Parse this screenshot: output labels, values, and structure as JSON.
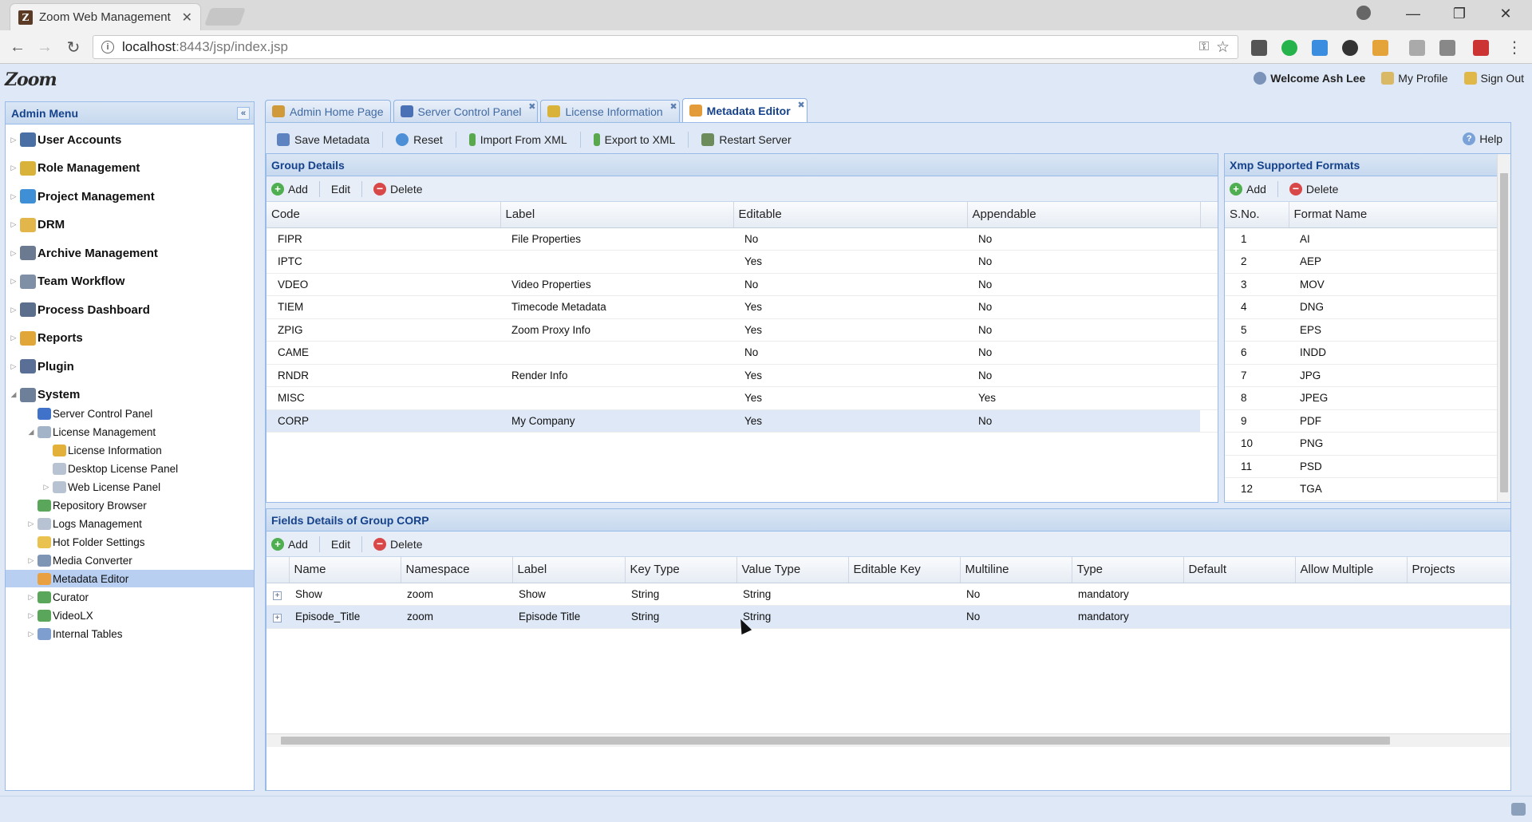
{
  "browser": {
    "tab_title": "Zoom Web Management",
    "tab_favicon": "Z",
    "url_host": "localhost",
    "url_rest": ":8443/jsp/index.jsp"
  },
  "app": {
    "logo": "Zoom",
    "welcome": "Welcome Ash Lee",
    "my_profile": "My Profile",
    "sign_out": "Sign Out"
  },
  "sidebar": {
    "title": "Admin Menu",
    "items": [
      {
        "label": "User Accounts",
        "icon": "users-icon"
      },
      {
        "label": "Role Management",
        "icon": "shield-icon"
      },
      {
        "label": "Project Management",
        "icon": "globe-icon"
      },
      {
        "label": "DRM",
        "icon": "folder-icon"
      },
      {
        "label": "Archive Management",
        "icon": "archive-icon"
      },
      {
        "label": "Team Workflow",
        "icon": "workflow-icon"
      },
      {
        "label": "Process Dashboard",
        "icon": "dashboard-icon"
      },
      {
        "label": "Reports",
        "icon": "reports-icon"
      },
      {
        "label": "Plugin",
        "icon": "plugin-icon"
      },
      {
        "label": "System",
        "icon": "system-icon"
      }
    ],
    "system_children": [
      {
        "label": "Server Control Panel",
        "level": 1
      },
      {
        "label": "License Management",
        "level": 1
      },
      {
        "label": "License Information",
        "level": 2
      },
      {
        "label": "Desktop License Panel",
        "level": 2
      },
      {
        "label": "Web License Panel",
        "level": 2
      },
      {
        "label": "Repository Browser",
        "level": 1
      },
      {
        "label": "Logs Management",
        "level": 1
      },
      {
        "label": "Hot Folder Settings",
        "level": 1
      },
      {
        "label": "Media Converter",
        "level": 1
      },
      {
        "label": "Metadata Editor",
        "level": 1
      },
      {
        "label": "Curator",
        "level": 1
      },
      {
        "label": "VideoLX",
        "level": 1
      },
      {
        "label": "Internal Tables",
        "level": 1
      }
    ]
  },
  "tabs": [
    {
      "label": "Admin Home Page"
    },
    {
      "label": "Server Control Panel"
    },
    {
      "label": "License Information"
    },
    {
      "label": "Metadata Editor"
    }
  ],
  "toolbar": {
    "save": "Save Metadata",
    "reset": "Reset",
    "import": "Import From XML",
    "export": "Export to XML",
    "restart": "Restart Server",
    "help": "Help"
  },
  "group_details": {
    "title": "Group Details",
    "add": "Add",
    "edit": "Edit",
    "delete": "Delete",
    "columns": [
      "Code",
      "Label",
      "Editable",
      "Appendable"
    ],
    "rows": [
      [
        "FIPR",
        "File Properties",
        "No",
        "No"
      ],
      [
        "IPTC",
        "",
        "Yes",
        "No"
      ],
      [
        "VDEO",
        "Video Properties",
        "No",
        "No"
      ],
      [
        "TIEM",
        "Timecode Metadata",
        "Yes",
        "No"
      ],
      [
        "ZPIG",
        "Zoom Proxy Info",
        "Yes",
        "No"
      ],
      [
        "CAME",
        "",
        "No",
        "No"
      ],
      [
        "RNDR",
        "Render Info",
        "Yes",
        "No"
      ],
      [
        "MISC",
        "",
        "Yes",
        "Yes"
      ],
      [
        "CORP",
        "My Company",
        "Yes",
        "No"
      ]
    ]
  },
  "xmp_formats": {
    "title": "Xmp Supported Formats",
    "add": "Add",
    "delete": "Delete",
    "columns": [
      "S.No.",
      "Format Name"
    ],
    "rows": [
      [
        "1",
        "AI"
      ],
      [
        "2",
        "AEP"
      ],
      [
        "3",
        "MOV"
      ],
      [
        "4",
        "DNG"
      ],
      [
        "5",
        "EPS"
      ],
      [
        "6",
        "INDD"
      ],
      [
        "7",
        "JPG"
      ],
      [
        "8",
        "JPEG"
      ],
      [
        "9",
        "PDF"
      ],
      [
        "10",
        "PNG"
      ],
      [
        "11",
        "PSD"
      ],
      [
        "12",
        "TGA"
      ]
    ]
  },
  "fields": {
    "title": "Fields Details of Group CORP",
    "add": "Add",
    "edit": "Edit",
    "delete": "Delete",
    "columns": [
      "Name",
      "Namespace",
      "Label",
      "Key Type",
      "Value Type",
      "Editable Key",
      "Multiline",
      "Type",
      "Default",
      "Allow Multiple",
      "Projects"
    ],
    "rows": [
      [
        "Show",
        "zoom",
        "Show",
        "String",
        "String",
        "",
        "No",
        "mandatory",
        "",
        "",
        ""
      ],
      [
        "Episode_Title",
        "zoom",
        "Episode Title",
        "String",
        "String",
        "",
        "No",
        "mandatory",
        "",
        "",
        ""
      ]
    ]
  },
  "colors": {
    "header_text": "#15428b",
    "panel_border": "#99bbe8",
    "selection": "#b8cff1"
  }
}
